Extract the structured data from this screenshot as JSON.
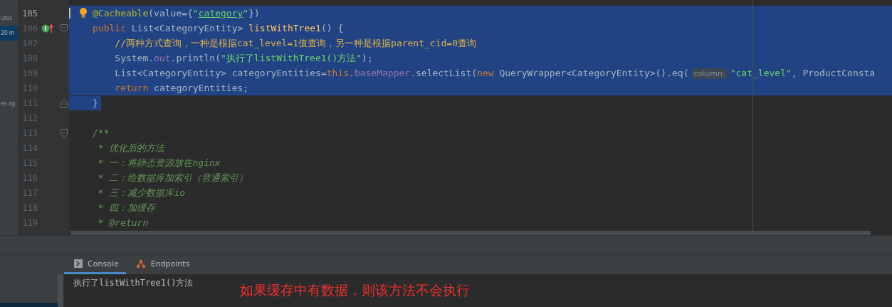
{
  "left_panel": {
    "items": [
      {
        "text": "utes",
        "selected": false
      },
      {
        "text": "20 m",
        "selected": true
      },
      {
        "text": "es ag",
        "selected": false
      }
    ]
  },
  "editor": {
    "lines": [
      {
        "number": "105",
        "current": true,
        "intention": true,
        "implements": false,
        "fold_start": false,
        "fold_end": false,
        "selected": true,
        "tokens": [
          {
            "kind": "annotation",
            "text": "@Cacheable"
          },
          {
            "kind": "plain",
            "text": "(value={"
          },
          {
            "kind": "string",
            "text": "\""
          },
          {
            "kind": "link",
            "text": "category"
          },
          {
            "kind": "string",
            "text": "\""
          },
          {
            "kind": "plain",
            "text": "})"
          }
        ]
      },
      {
        "number": "106",
        "current": false,
        "intention": false,
        "implements": true,
        "fold_start": true,
        "fold_end": false,
        "selected": true,
        "tokens": [
          {
            "kind": "keyword",
            "text": "public"
          },
          {
            "kind": "plain",
            "text": " List<CategoryEntity> "
          },
          {
            "kind": "method",
            "text": "listWithTree1"
          },
          {
            "kind": "plain",
            "text": "() {"
          }
        ]
      },
      {
        "number": "107",
        "current": false,
        "intention": false,
        "implements": false,
        "fold_start": false,
        "fold_end": false,
        "selected": true,
        "tokens": [
          {
            "kind": "comment",
            "text": "    //两种方式查询，一种是根据cat_level=1值查询，另一种是根据parent_cid=0查询"
          }
        ]
      },
      {
        "number": "108",
        "current": false,
        "intention": false,
        "implements": false,
        "fold_start": false,
        "fold_end": false,
        "selected": true,
        "tokens": [
          {
            "kind": "plain",
            "text": "    System."
          },
          {
            "kind": "static",
            "text": "out"
          },
          {
            "kind": "plain",
            "text": ".println("
          },
          {
            "kind": "string",
            "text": "\"执行了listWithTree1()方法\""
          },
          {
            "kind": "plain",
            "text": ");"
          }
        ]
      },
      {
        "number": "109",
        "current": false,
        "intention": false,
        "implements": false,
        "fold_start": false,
        "fold_end": false,
        "selected": true,
        "tokens": [
          {
            "kind": "plain",
            "text": "    List<CategoryEntity> categoryEntities="
          },
          {
            "kind": "keyword",
            "text": "this"
          },
          {
            "kind": "plain",
            "text": "."
          },
          {
            "kind": "field",
            "text": "baseMapper"
          },
          {
            "kind": "plain",
            "text": ".selectList("
          },
          {
            "kind": "keyword",
            "text": "new"
          },
          {
            "kind": "plain",
            "text": " QueryWrapper<CategoryEntity>().eq("
          },
          {
            "kind": "hint",
            "text": "column:"
          },
          {
            "kind": "string",
            "text": "\"cat_level\""
          },
          {
            "kind": "plain",
            "text": ", ProductConsta"
          }
        ]
      },
      {
        "number": "110",
        "current": false,
        "intention": false,
        "implements": false,
        "fold_start": false,
        "fold_end": false,
        "selected": true,
        "tokens": [
          {
            "kind": "keyword",
            "text": "    return"
          },
          {
            "kind": "plain",
            "text": " categoryEntities;"
          }
        ]
      },
      {
        "number": "111",
        "current": false,
        "intention": false,
        "implements": false,
        "fold_start": false,
        "fold_end": true,
        "selected": true,
        "tokens": [
          {
            "kind": "plain",
            "text": "}"
          }
        ]
      },
      {
        "number": "112",
        "current": false,
        "intention": false,
        "implements": false,
        "fold_start": false,
        "fold_end": false,
        "selected": false
      },
      {
        "number": "113",
        "current": false,
        "intention": false,
        "implements": false,
        "fold_start": true,
        "fold_end": false,
        "selected": false,
        "tokens": [
          {
            "kind": "doc",
            "text": "/**"
          }
        ]
      },
      {
        "number": "114",
        "current": false,
        "intention": false,
        "implements": false,
        "fold_start": false,
        "fold_end": false,
        "selected": false,
        "tokens": [
          {
            "kind": "doc",
            "text": " * 优化后的方法"
          }
        ]
      },
      {
        "number": "115",
        "current": false,
        "intention": false,
        "implements": false,
        "fold_start": false,
        "fold_end": false,
        "selected": false,
        "tokens": [
          {
            "kind": "doc",
            "text": " * 一：将静态资源放在nginx"
          }
        ]
      },
      {
        "number": "116",
        "current": false,
        "intention": false,
        "implements": false,
        "fold_start": false,
        "fold_end": false,
        "selected": false,
        "tokens": [
          {
            "kind": "doc",
            "text": " * 二：给数据库加索引（普通索引）"
          }
        ]
      },
      {
        "number": "117",
        "current": false,
        "intention": false,
        "implements": false,
        "fold_start": false,
        "fold_end": false,
        "selected": false,
        "tokens": [
          {
            "kind": "doc",
            "text": " * 三：减少数据库io"
          }
        ]
      },
      {
        "number": "118",
        "current": false,
        "intention": false,
        "implements": false,
        "fold_start": false,
        "fold_end": false,
        "selected": false,
        "tokens": [
          {
            "kind": "doc",
            "text": " * 四：加缓存"
          }
        ]
      },
      {
        "number": "119",
        "current": false,
        "intention": false,
        "implements": false,
        "fold_start": false,
        "fold_end": false,
        "selected": false,
        "tokens": [
          {
            "kind": "doctag",
            "text": " * @return"
          }
        ]
      }
    ]
  },
  "tool_window": {
    "tabs": [
      {
        "label": "Console",
        "selected": true
      },
      {
        "label": "Endpoints",
        "selected": false
      }
    ],
    "output": "执行了listWithTree1()方法",
    "annotation": "如果缓存中有数据，则该方法不会执行"
  }
}
